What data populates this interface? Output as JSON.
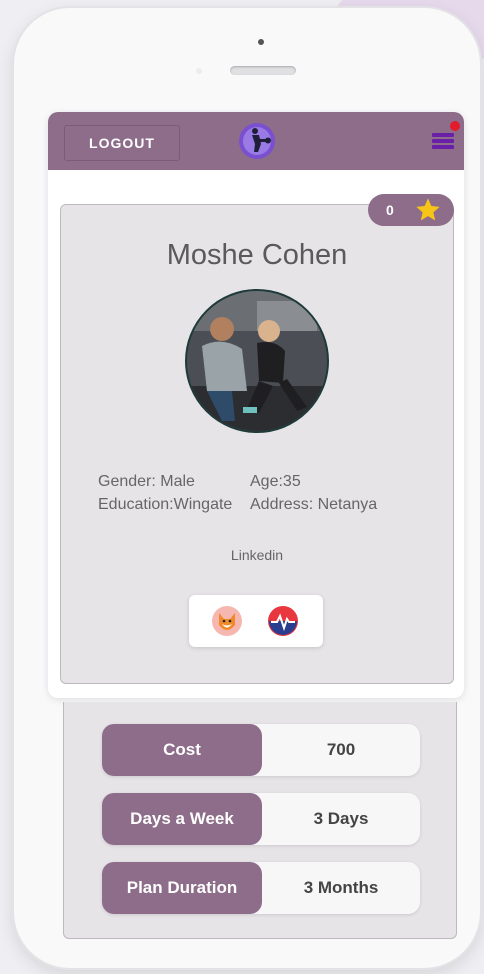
{
  "header": {
    "logout_label": "LOGOUT",
    "logo_icon": "fitness-logo-icon",
    "menu_icon": "hamburger-menu-icon",
    "notification_dot_color": "#e41b2c"
  },
  "colors": {
    "brand": "#8d6d89",
    "menu": "#6a1fa8",
    "star": "#f7c518"
  },
  "profile": {
    "rating": "0",
    "name": "Moshe Cohen",
    "gender": "Gender: Male",
    "age": "Age:35",
    "education": "Education:Wingate",
    "address": "Address: Netanya",
    "linkedin": "Linkedin",
    "badges": [
      "fox-badge-icon",
      "heartbeat-badge-icon"
    ]
  },
  "plan": {
    "rows": [
      {
        "label": "Cost",
        "value": "700"
      },
      {
        "label": "Days a Week",
        "value": "3 Days"
      },
      {
        "label": "Plan Duration",
        "value": "3 Months"
      }
    ]
  }
}
